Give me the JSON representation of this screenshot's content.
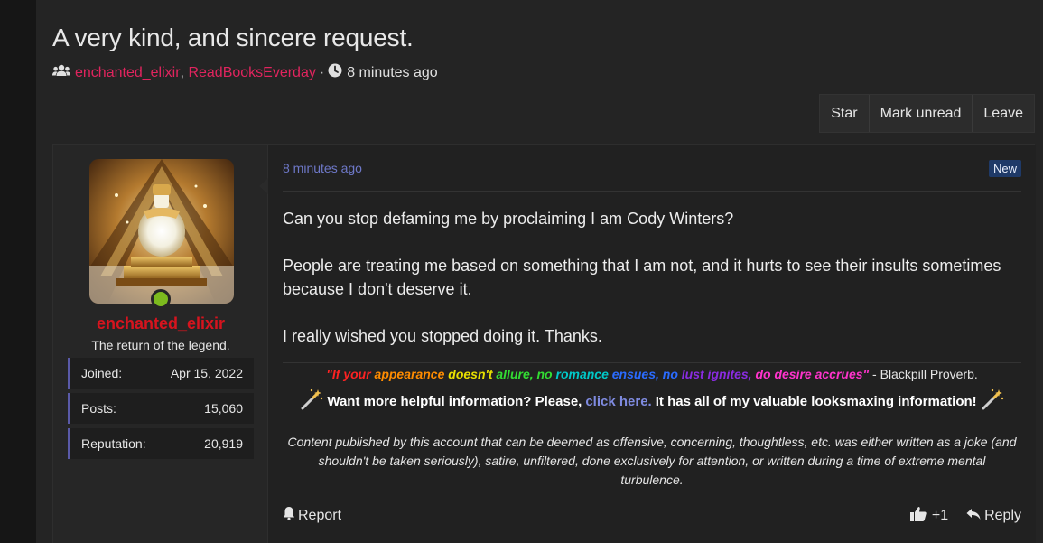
{
  "thread": {
    "title": "A very kind, and sincere request.",
    "participants": [
      "enchanted_elixir",
      "ReadBooksEverday"
    ],
    "participant_sep": ",",
    "dot": "·",
    "time": "8 minutes ago",
    "icons": {
      "participants": "users-icon",
      "time": "clock-icon"
    }
  },
  "toolbar": {
    "star_label": "Star",
    "mark_unread_label": "Mark unread",
    "leave_label": "Leave"
  },
  "user": {
    "name": "enchanted_elixir",
    "title": "The return of the legend.",
    "status_color": "#7cba1e",
    "stats": [
      {
        "label": "Joined:",
        "value": "Apr 15, 2022"
      },
      {
        "label": "Posts:",
        "value": "15,060"
      },
      {
        "label": "Reputation:",
        "value": "20,919"
      }
    ]
  },
  "post": {
    "timestamp": "8 minutes ago",
    "badge": "New",
    "paragraphs": [
      "Can you stop defaming me by proclaiming I am Cody Winters?",
      "People are treating me based on something that I am not, and it hurts to see their insults sometimes because I don't deserve it.",
      "I really wished you stopped doing it. Thanks."
    ],
    "signature": {
      "quote_parts": [
        "\"If your ",
        "appearance ",
        "doesn't ",
        "allure, no ",
        "romance ",
        "ensues, no ",
        "lust ignites, ",
        "do desire accrues\""
      ],
      "proverb": " - Blackpill Proverb.",
      "line2_before": "Want more helpful information? Please,",
      "line2_link": "click here.",
      "line2_after": "It has all of my valuable looksmaxing information!",
      "wand_icon": "magic-wand-icon",
      "disclaimer": "Content published by this account that can be deemed as offensive, concerning, thoughtless, etc. was either written as a joke (and shouldn't be taken seriously), satire, unfiltered, done exclusively for attention, or written during a time of extreme mental turbulence."
    },
    "actions": {
      "report_label": "Report",
      "like_count": "+1",
      "reply_label": "Reply"
    }
  }
}
